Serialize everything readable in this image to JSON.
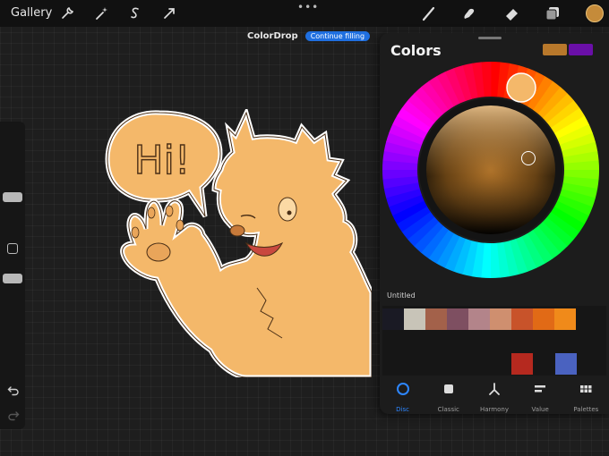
{
  "topbar": {
    "gallery_label": "Gallery",
    "more_label": "•••",
    "tools_left": [
      "wrench-icon",
      "magic-wand-icon",
      "selection-icon",
      "transform-icon"
    ],
    "tools_right": [
      "brush-icon",
      "smudge-icon",
      "eraser-icon",
      "layers-icon"
    ],
    "current_color": "#c58b3a"
  },
  "notice": {
    "title": "ColorDrop",
    "action_label": "Continue filling"
  },
  "artwork": {
    "speech_text": "Hi!",
    "fill_color": "#f4b86a",
    "outline_color": "#ffffff"
  },
  "colors_panel": {
    "title": "Colors",
    "primary_color": "#b8782b",
    "secondary_color": "#6a0fa8",
    "palette_name": "Untitled",
    "palette_row": [
      "#1a1a24",
      "#c8c4b8",
      "#a3614a",
      "#7e4f61",
      "#b3848a",
      "#cf8f6f",
      "#c8532a",
      "#e16a16",
      "#f08a1a"
    ],
    "palette_extra": [
      "#b5291f",
      "#4a62c0"
    ],
    "tabs": [
      {
        "label": "Disc",
        "icon": "disc-icon",
        "active": true
      },
      {
        "label": "Classic",
        "icon": "classic-icon",
        "active": false
      },
      {
        "label": "Harmony",
        "icon": "harmony-icon",
        "active": false
      },
      {
        "label": "Value",
        "icon": "value-icon",
        "active": false
      },
      {
        "label": "Palettes",
        "icon": "palettes-icon",
        "active": false
      }
    ]
  }
}
